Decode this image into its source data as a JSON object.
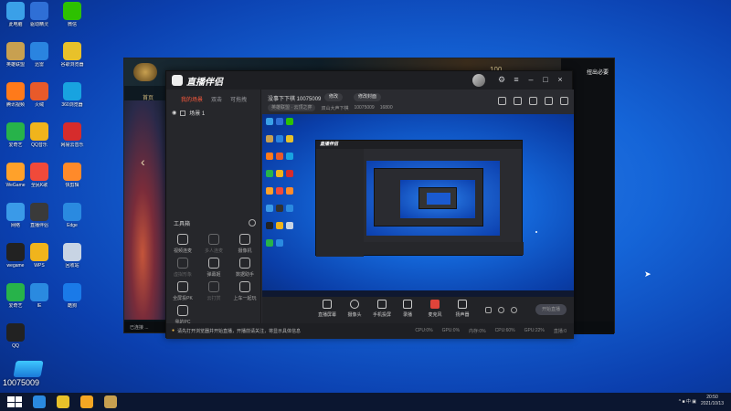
{
  "desktop_icons": [
    {
      "label": "此电脑",
      "color": "#3aa0e8"
    },
    {
      "label": "驱动精灵",
      "color": "#2f6fd6"
    },
    {
      "label": "微信",
      "color": "#2dc100"
    },
    {
      "label": "英雄联盟",
      "color": "#c8a050"
    },
    {
      "label": "迅雷",
      "color": "#2a84e0"
    },
    {
      "label": "谷歌浏览器",
      "color": "#e8c12a"
    },
    {
      "label": "腾讯视频",
      "color": "#ff7a1a"
    },
    {
      "label": "火绒",
      "color": "#e85a2a"
    },
    {
      "label": "360浏览器",
      "color": "#18a3e0"
    },
    {
      "label": "爱奇艺",
      "color": "#27b34a"
    },
    {
      "label": "QQ音乐",
      "color": "#f0b41c"
    },
    {
      "label": "网易云音乐",
      "color": "#d62c2c"
    },
    {
      "label": "WeGame",
      "color": "#ffa12a"
    },
    {
      "label": "全民K歌",
      "color": "#f04a3a"
    },
    {
      "label": "快剪辑",
      "color": "#ff8a2a"
    },
    {
      "label": "网络",
      "color": "#3a9ae8"
    },
    {
      "label": "直播伴侣",
      "color": "#3a3a3a"
    },
    {
      "label": "Edge",
      "color": "#2a8ae0"
    },
    {
      "label": "wegame",
      "color": "#222"
    },
    {
      "label": "WPS",
      "color": "#f0b41c"
    },
    {
      "label": "回收站",
      "color": "#c8d4e4"
    },
    {
      "label": "爱奇艺",
      "color": "#27b34a"
    },
    {
      "label": "IE",
      "color": "#2a8ae0"
    },
    {
      "label": "酷狗",
      "color": "#1a7ae8"
    },
    {
      "label": "QQ",
      "color": "#222"
    }
  ],
  "overlay": {
    "id": "10075009"
  },
  "game_window": {
    "score": "100",
    "home": "首页",
    "right_title": "扭出必要",
    "arrow": "‹",
    "bottom_text": "已连接 ..."
  },
  "app": {
    "title": "直播伴侣",
    "left_tabs": [
      "我的场景",
      "双击",
      "可拖拽"
    ],
    "scene_name": "场景 1",
    "tools_label": "工具箱",
    "tools": [
      {
        "label": "视频连麦",
        "dim": false
      },
      {
        "label": "多人连麦",
        "dim": true
      },
      {
        "label": "摄像机",
        "dim": false
      },
      {
        "label": "虚拟形象",
        "dim": true
      },
      {
        "label": "弹幕姬",
        "dim": false
      },
      {
        "label": "数据助手",
        "dim": false
      },
      {
        "label": "全屏投PK",
        "dim": false
      },
      {
        "label": "云打赏",
        "dim": true
      },
      {
        "label": "上车一起玩",
        "dim": false
      },
      {
        "label": "我的PC",
        "dim": false
      }
    ],
    "room": {
      "title": "没事下下棋 10075009",
      "edit_label": "修改",
      "cover_label": "修改封面",
      "category": "英雄联盟 · 云顶之弈",
      "partner": "双山大声下棋",
      "id": "10075009",
      "fans": "16800"
    },
    "bottom_tools": [
      "直播屏幕",
      "摄像头",
      "手机投屏",
      "录播",
      "麦克风",
      "扬声器"
    ],
    "start_label": "开始直播",
    "status_text": "请先打开浏览器并开始直播，开播前请关注，将显示具体信息",
    "stats": [
      "CPU:0%",
      "GPU:0%",
      "内存:0%",
      "CPU:60%",
      "GPU:22%",
      "直播:0"
    ]
  },
  "taskbar": {
    "time": "20:50",
    "date": "2021/10/13",
    "apps": [
      {
        "name": "edge",
        "color": "#2a8ae0"
      },
      {
        "name": "chrome",
        "color": "#e8c12a"
      },
      {
        "name": "live-companion",
        "color": "#f5a623"
      },
      {
        "name": "league",
        "color": "#c8a050"
      }
    ],
    "tray_text": "^ ■ 中 ▣"
  }
}
